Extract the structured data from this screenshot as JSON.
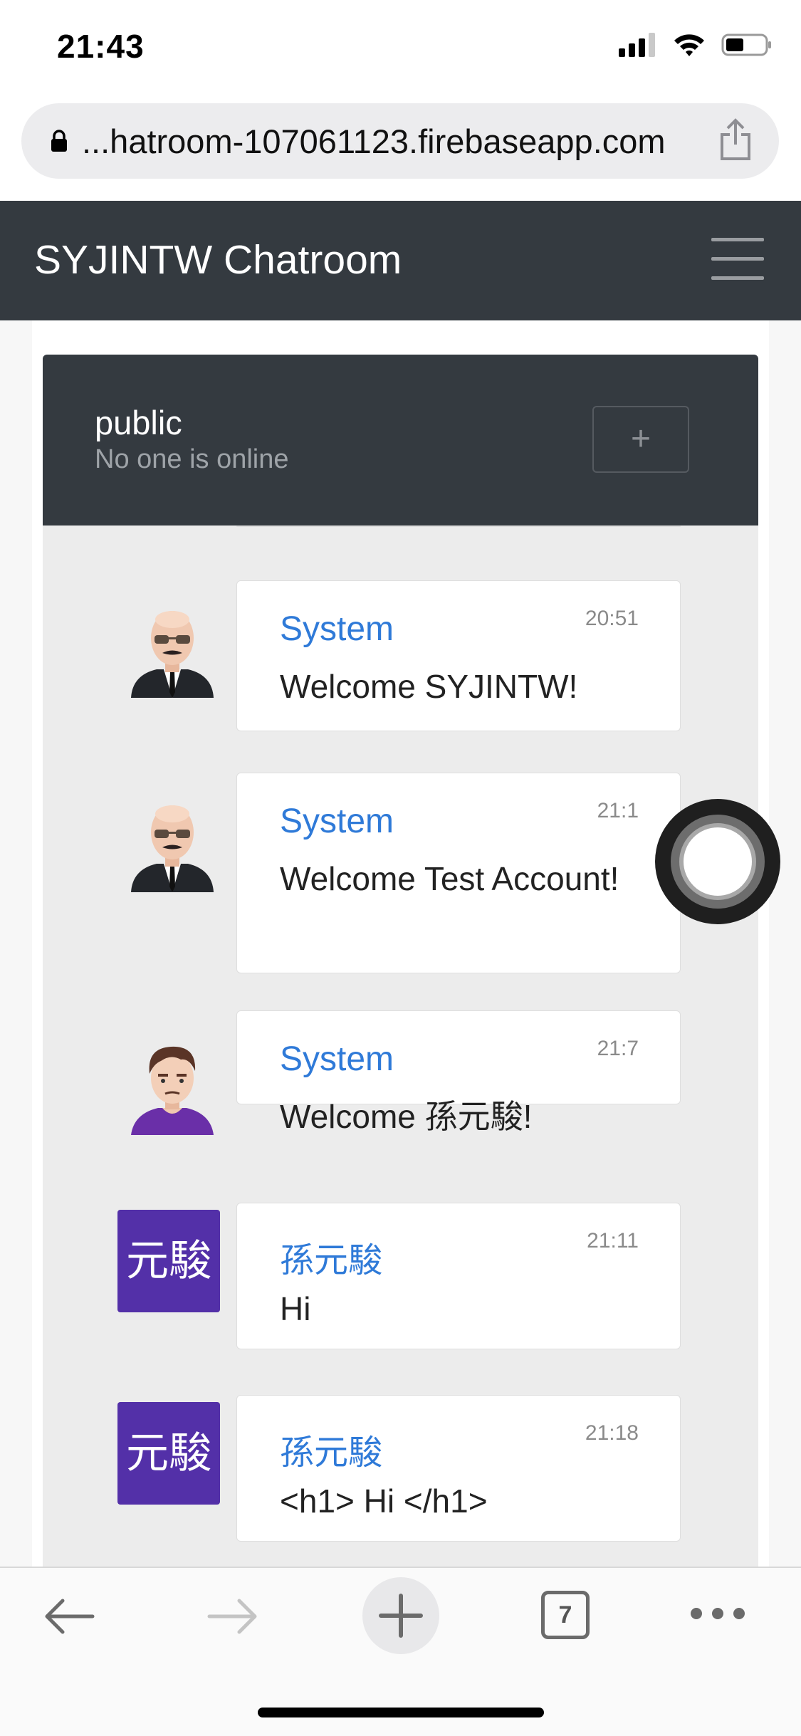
{
  "status_bar": {
    "time": "21:43"
  },
  "browser": {
    "url": "...hatroom-107061123.firebaseapp.com"
  },
  "navbar": {
    "brand": "SYJINTW Chatroom"
  },
  "room": {
    "name": "public",
    "status": "No one is online",
    "add_label": "+"
  },
  "messages": [
    {
      "sender": "System",
      "time": "20:51",
      "text": "Welcome SYJINTW!",
      "avatar": "bald-man-avatar"
    },
    {
      "sender": "System",
      "time": "21:1",
      "text": "Welcome Test Account!",
      "avatar": "bald-man-avatar"
    },
    {
      "sender": "System",
      "time": "21:7",
      "text": "Welcome 孫元駿!",
      "avatar": "brown-hair-man-avatar"
    },
    {
      "sender": "孫元駿",
      "time": "21:11",
      "text": "Hi",
      "avatar_text": "元駿"
    },
    {
      "sender": "孫元駿",
      "time": "21:18",
      "text": "<h1> Hi </h1>",
      "avatar_text": "元駿"
    }
  ],
  "toolbar": {
    "tab_count": "7"
  },
  "colors": {
    "navbar": "#343a40",
    "sender": "#2f7ad8",
    "text_avatar": "#5330a8"
  }
}
